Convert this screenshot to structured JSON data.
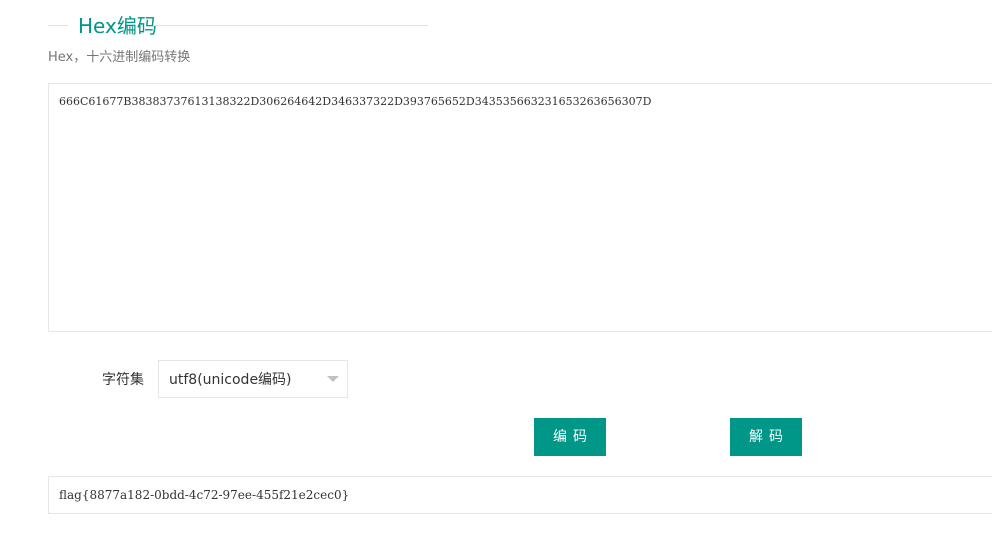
{
  "header": {
    "title": "Hex编码",
    "subtitle": "Hex，十六进制编码转换"
  },
  "input": {
    "value": "666C61677B38383737613138322D306264642D346337322D393765652D343535663231653263656307D"
  },
  "charset": {
    "label": "字符集",
    "selected": "utf8(unicode编码)",
    "arrow_icon": "chevron-down-icon"
  },
  "actions": {
    "encode_label": "编码",
    "decode_label": "解码"
  },
  "output": {
    "value": "flag{8877a182-0bdd-4c72-97ee-455f21e2cec0}"
  },
  "colors": {
    "accent": "#009688",
    "border": "#e6e6e6",
    "text": "#333333",
    "muted": "#777777"
  }
}
